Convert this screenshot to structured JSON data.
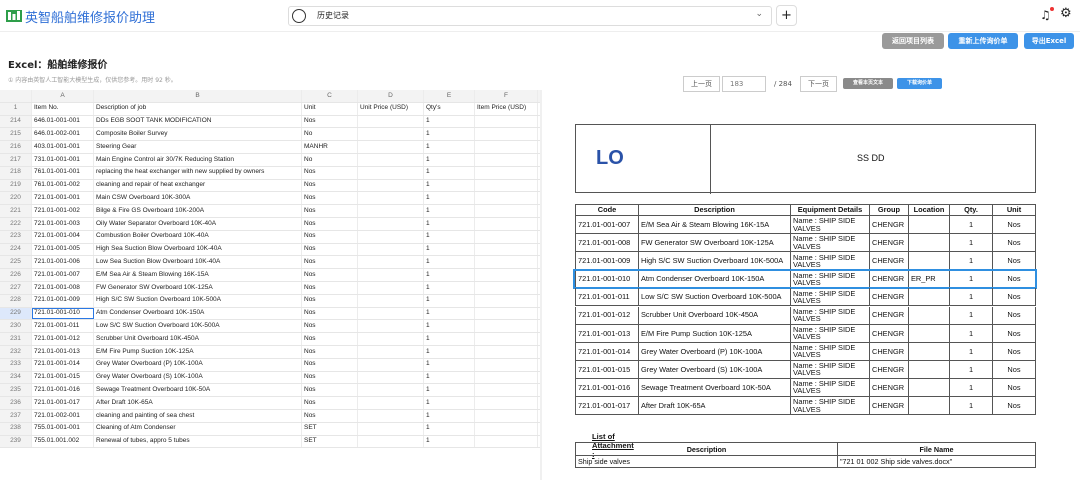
{
  "app": {
    "title": "英智船舶维修报价助理",
    "history_label": "历史记录",
    "accent": "#3d93e8"
  },
  "actions": {
    "back": "返回项目列表",
    "reupload": "重新上传询价单",
    "export": "导出Excel"
  },
  "sheet": {
    "title": "Excel：船舶维修报价",
    "note": "① 内容由英智人工智能大模型生成，仅供您参考。用时 92 秒。",
    "col_letters": [
      "",
      "A",
      "B",
      "C",
      "D",
      "E",
      "F"
    ],
    "header_row": [
      "1",
      "Item No.",
      "Description of job",
      "Unit",
      "Unit Price (USD)",
      "Qty's",
      "Item Price (USD)"
    ],
    "rows": [
      [
        "214",
        "646.01-001-001",
        "DDs EGB SOOT TANK MODIFICATION",
        "Nos",
        "",
        "1",
        ""
      ],
      [
        "215",
        "646.01-002-001",
        "Composite Boiler Survey",
        "No",
        "",
        "1",
        ""
      ],
      [
        "216",
        "403.01-001-001",
        "Steering Gear",
        "MANHR",
        "",
        "1",
        ""
      ],
      [
        "217",
        "731.01-001-001",
        "Main Engine Control air 30/7K Reducing Station",
        "No",
        "",
        "1",
        ""
      ],
      [
        "218",
        "761.01-001-001",
        "replacing the heat exchanger with new supplied by owners",
        "Nos",
        "",
        "1",
        ""
      ],
      [
        "219",
        "761.01-001-002",
        "cleaning and repair of heat exchanger",
        "Nos",
        "",
        "1",
        ""
      ],
      [
        "220",
        "721.01-001-001",
        "Main CSW Overboard 10K-300A",
        "Nos",
        "",
        "1",
        ""
      ],
      [
        "221",
        "721.01-001-002",
        "Bilge & Fire GS Overboard 10K-200A",
        "Nos",
        "",
        "1",
        ""
      ],
      [
        "222",
        "721.01-001-003",
        "Oily Water Separator Overboard 10K-40A",
        "Nos",
        "",
        "1",
        ""
      ],
      [
        "223",
        "721.01-001-004",
        "Combustion Boiler Overboard 10K-40A",
        "Nos",
        "",
        "1",
        ""
      ],
      [
        "224",
        "721.01-001-005",
        "High Sea Suction Blow Overboard 10K-40A",
        "Nos",
        "",
        "1",
        ""
      ],
      [
        "225",
        "721.01-001-006",
        "Low Sea Suction Blow Overboard 10K-40A",
        "Nos",
        "",
        "1",
        ""
      ],
      [
        "226",
        "721.01-001-007",
        "E/M Sea Air & Steam Blowing 16K-15A",
        "Nos",
        "",
        "1",
        ""
      ],
      [
        "227",
        "721.01-001-008",
        "FW Generator SW Overboard 10K-125A",
        "Nos",
        "",
        "1",
        ""
      ],
      [
        "228",
        "721.01-001-009",
        "High S/C SW Suction Overboard 10K-500A",
        "Nos",
        "",
        "1",
        ""
      ],
      [
        "229",
        "721.01-001-010",
        "Atm Condenser Overboard 10K-150A",
        "Nos",
        "",
        "1",
        ""
      ],
      [
        "230",
        "721.01-001-011",
        "Low S/C SW Suction Overboard 10K-500A",
        "Nos",
        "",
        "1",
        ""
      ],
      [
        "231",
        "721.01-001-012",
        "Scrubber Unit Overboard 10K-450A",
        "Nos",
        "",
        "1",
        ""
      ],
      [
        "232",
        "721.01-001-013",
        "E/M Fire Pump Suction 10K-125A",
        "Nos",
        "",
        "1",
        ""
      ],
      [
        "233",
        "721.01-001-014",
        "Grey Water Overboard (P) 10K-100A",
        "Nos",
        "",
        "1",
        ""
      ],
      [
        "234",
        "721.01-001-015",
        "Grey Water Overboard (S) 10K-100A",
        "Nos",
        "",
        "1",
        ""
      ],
      [
        "235",
        "721.01-001-016",
        "Sewage Treatment Overboard 10K-50A",
        "Nos",
        "",
        "1",
        ""
      ],
      [
        "236",
        "721.01-001-017",
        "After Draft 10K-65A",
        "Nos",
        "",
        "1",
        ""
      ],
      [
        "237",
        "721.01-002-001",
        "cleaning and painting of sea chest",
        "Nos",
        "",
        "1",
        ""
      ],
      [
        "238",
        "755.01-001-001",
        "Cleaning of Atm Condenser",
        "SET",
        "",
        "1",
        ""
      ],
      [
        "239",
        "755.01.001.002",
        "Renewal of tubes, appro 5 tubes",
        "SET",
        "",
        "1",
        ""
      ]
    ],
    "selected_row": "229"
  },
  "pager": {
    "prev": "上一页",
    "page": "183",
    "total": "/ 284",
    "next": "下一页",
    "view_text": "查看本页文本",
    "download": "下载询价单"
  },
  "doc": {
    "lo": "LO",
    "ss": "SS DD",
    "headers": [
      "Code",
      "Description",
      "Equipment Details",
      "Group",
      "Location",
      "Qty.",
      "Unit"
    ],
    "rows": [
      [
        "721.01-001-007",
        "E/M Sea Air & Steam Blowing 16K-15A",
        "Name : SHIP SIDE VALVES",
        "CHENGR",
        "",
        "1",
        "Nos"
      ],
      [
        "721.01-001-008",
        "FW Generator SW Overboard 10K-125A",
        "Name : SHIP SIDE VALVES",
        "CHENGR",
        "",
        "1",
        "Nos"
      ],
      [
        "721.01-001-009",
        "High S/C SW Suction Overboard 10K-500A",
        "Name : SHIP SIDE VALVES",
        "CHENGR",
        "",
        "1",
        "Nos"
      ],
      [
        "721.01-001-010",
        "Atm Condenser Overboard 10K-150A",
        "Name : SHIP SIDE VALVES",
        "CHENGR",
        "ER_PR",
        "1",
        "Nos"
      ],
      [
        "721.01-001-011",
        "Low S/C SW Suction Overboard 10K-500A",
        "Name : SHIP SIDE VALVES",
        "CHENGR",
        "",
        "1",
        "Nos"
      ],
      [
        "721.01-001-012",
        "Scrubber Unit Overboard 10K-450A",
        "Name : SHIP SIDE VALVES",
        "CHENGR",
        "",
        "1",
        "Nos"
      ],
      [
        "721.01-001-013",
        "E/M Fire Pump Suction 10K-125A",
        "Name : SHIP SIDE VALVES",
        "CHENGR",
        "",
        "1",
        "Nos"
      ],
      [
        "721.01-001-014",
        "Grey Water Overboard (P) 10K-100A",
        "Name : SHIP SIDE VALVES",
        "CHENGR",
        "",
        "1",
        "Nos"
      ],
      [
        "721.01-001-015",
        "Grey Water Overboard (S) 10K-100A",
        "Name : SHIP SIDE VALVES",
        "CHENGR",
        "",
        "1",
        "Nos"
      ],
      [
        "721.01-001-016",
        "Sewage Treatment Overboard 10K-50A",
        "Name : SHIP SIDE VALVES",
        "CHENGR",
        "",
        "1",
        "Nos"
      ],
      [
        "721.01-001-017",
        "After Draft 10K-65A",
        "Name : SHIP SIDE VALVES",
        "CHENGR",
        "",
        "1",
        "Nos"
      ]
    ],
    "highlighted_code": "721.01-001-010",
    "attachment_title": "List of  Attachment :",
    "att_headers": [
      "Description",
      "File Name"
    ],
    "att_rows": [
      [
        "Ship side valves",
        "\"721 01 002 Ship side valves.docx\""
      ]
    ]
  }
}
